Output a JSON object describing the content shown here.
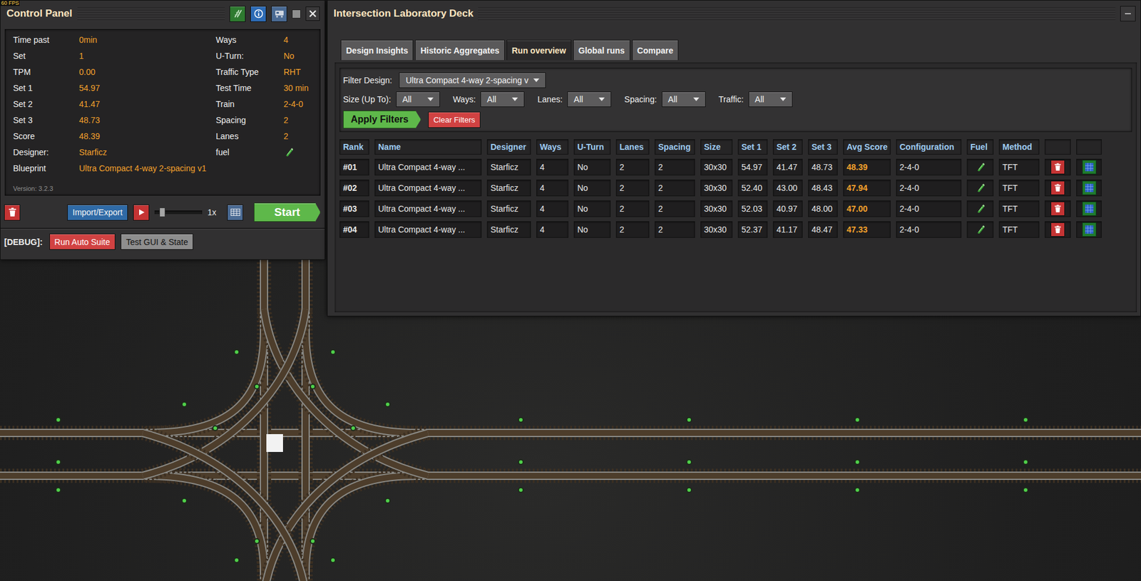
{
  "fps": "60 FPS",
  "control_panel": {
    "title": "Control Panel",
    "stats": [
      {
        "left": {
          "label": "Time past",
          "value": "0min"
        },
        "right": {
          "label": "Ways",
          "value": "4",
          "kind": "text"
        }
      },
      {
        "left": {
          "label": "Set",
          "value": "1"
        },
        "right": {
          "label": "U-Turn:",
          "value": "No",
          "kind": "text"
        }
      },
      {
        "left": {
          "label": "TPM",
          "value": "0.00"
        },
        "right": {
          "label": "Traffic Type",
          "value": "RHT",
          "kind": "text"
        }
      },
      {
        "left": {
          "label": "Set 1",
          "value": "54.97"
        },
        "right": {
          "label": "Test Time",
          "value": "30 min",
          "kind": "text"
        }
      },
      {
        "left": {
          "label": "Set 2",
          "value": "41.47"
        },
        "right": {
          "label": "Train",
          "value": "2-4-0",
          "kind": "text"
        }
      },
      {
        "left": {
          "label": "Set 3",
          "value": "48.73"
        },
        "right": {
          "label": "Spacing",
          "value": "2",
          "kind": "text"
        }
      },
      {
        "left": {
          "label": "Score",
          "value": "48.39"
        },
        "right": {
          "label": "Lanes",
          "value": "2",
          "kind": "text"
        }
      },
      {
        "left": {
          "label": "Designer:",
          "value": "Starficz"
        },
        "right": {
          "label": "fuel",
          "kind": "icon"
        }
      }
    ],
    "blueprint": {
      "label": "Blueprint",
      "value": "Ultra Compact 4-way 2-spacing v1"
    },
    "version": "Version: 3.2.3",
    "toolbar": {
      "import_export": "Import/Export",
      "speed": {
        "level": 0.12,
        "reading": "1x"
      },
      "start": "Start"
    },
    "debug": {
      "label": "[DEBUG]:",
      "buttons": [
        {
          "label": "Run Auto Suite",
          "kind": "danger"
        },
        {
          "label": "Test GUI & State",
          "kind": "plain"
        }
      ]
    }
  },
  "deck": {
    "title": "Intersection Laboratory Deck",
    "tabs": [
      {
        "label": "Design Insights",
        "selected": false
      },
      {
        "label": "Historic Aggregates",
        "selected": false
      },
      {
        "label": "Run overview",
        "selected": true
      },
      {
        "label": "Global runs",
        "selected": false
      },
      {
        "label": "Compare",
        "selected": false
      }
    ],
    "filters": {
      "design": {
        "label": "Filter Design:",
        "value": "Ultra Compact 4-way 2-spacing v"
      },
      "fields": [
        {
          "label": "Size (Up To):",
          "value": "All"
        },
        {
          "label": "Ways:",
          "value": "All"
        },
        {
          "label": "Lanes:",
          "value": "All"
        },
        {
          "label": "Spacing:",
          "value": "All"
        },
        {
          "label": "Traffic:",
          "value": "All"
        }
      ],
      "apply": "Apply Filters",
      "clear": "Clear Filters"
    },
    "table": {
      "columns": [
        "Rank",
        "Name",
        "Designer",
        "Ways",
        "U-Turn",
        "Lanes",
        "Spacing",
        "Size",
        "Set 1",
        "Set 2",
        "Set 3",
        "Avg Score",
        "Configuration",
        "Fuel",
        "Method",
        "",
        ""
      ],
      "rows": [
        {
          "rank": "#01",
          "name": "Ultra Compact 4-way ...",
          "designer": "Starficz",
          "ways": "4",
          "uturn": "No",
          "lanes": "2",
          "spacing": "2",
          "size": "30x30",
          "set1": "54.97",
          "set2": "41.47",
          "set3": "48.73",
          "avg": "48.39",
          "config": "2-4-0",
          "fuel": true,
          "method": "TFT"
        },
        {
          "rank": "#02",
          "name": "Ultra Compact 4-way ...",
          "designer": "Starficz",
          "ways": "4",
          "uturn": "No",
          "lanes": "2",
          "spacing": "2",
          "size": "30x30",
          "set1": "52.40",
          "set2": "43.00",
          "set3": "48.43",
          "avg": "47.94",
          "config": "2-4-0",
          "fuel": true,
          "method": "TFT"
        },
        {
          "rank": "#03",
          "name": "Ultra Compact 4-way ...",
          "designer": "Starficz",
          "ways": "4",
          "uturn": "No",
          "lanes": "2",
          "spacing": "2",
          "size": "30x30",
          "set1": "52.03",
          "set2": "40.97",
          "set3": "48.00",
          "avg": "47.00",
          "config": "2-4-0",
          "fuel": true,
          "method": "TFT"
        },
        {
          "rank": "#04",
          "name": "Ultra Compact 4-way ...",
          "designer": "Starficz",
          "ways": "4",
          "uturn": "No",
          "lanes": "2",
          "spacing": "2",
          "size": "30x30",
          "set1": "52.37",
          "set2": "41.17",
          "set3": "48.47",
          "avg": "47.33",
          "config": "2-4-0",
          "fuel": true,
          "method": "TFT"
        }
      ]
    }
  }
}
